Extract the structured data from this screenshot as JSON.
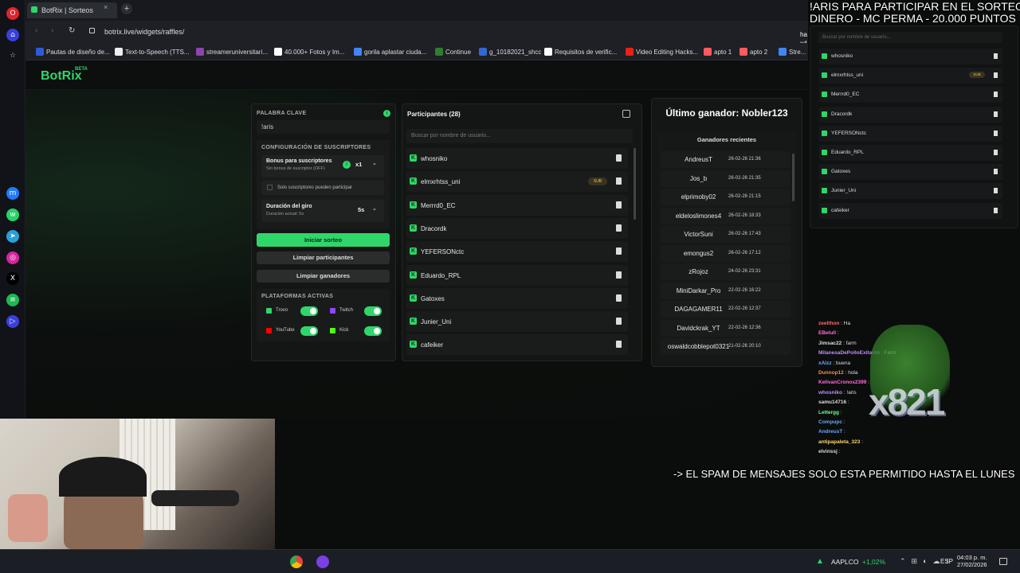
{
  "browser": {
    "tab_title": "BotRix | Sorteos",
    "tab_close": "×",
    "new_tab": "+",
    "url": "botrix.live/widgets/raffles/",
    "bookmarks": [
      "Pautas de diseño de...",
      "Text-to-Speech (TTS...",
      "streameruniversitari...",
      "40.000+ Fotos y Im...",
      "gorila aplastar ciuda...",
      "Continue",
      "g_10182021_shcc",
      "Requisitos de verific...",
      "Video Editing Hacks...",
      "apto 1",
      "apto 2",
      "Stre..."
    ],
    "partial_text": "ha xd"
  },
  "site": {
    "logo": "BotRix",
    "beta": "BETA"
  },
  "config": {
    "keyword_label": "PALABRA CLAVE",
    "keyword_value": "!aris",
    "subs_title": "CONFIGURACIÓN DE SUSCRIPTORES",
    "bonus_label": "Bonus para suscriptores",
    "bonus_sub": "Sin bonus de suscriptor (OFF)",
    "bonus_value": "x1",
    "subs_only": "Solo suscriptores pueden participar",
    "duration_label": "Duración del giro",
    "duration_sub": "Duración actual: 5s",
    "duration_value": "5s",
    "start_btn": "Iniciar sorteo",
    "clear_participants": "Limpiar participantes",
    "clear_winners": "Limpiar ganadores",
    "platforms_title": "PLATAFORMAS ACTIVAS",
    "platforms": [
      {
        "name": "Trovo",
        "on": true
      },
      {
        "name": "Twitch",
        "on": true
      },
      {
        "name": "YouTube",
        "on": true
      },
      {
        "name": "Kick",
        "on": true
      }
    ],
    "accent": "#2fd66a"
  },
  "participants": {
    "title": "Participantes (28)",
    "search_placeholder": "Buscar por nombre de usuario...",
    "list": [
      "whosniko",
      "elmxrhtss_uni",
      "Merrrd0_EC",
      "Dracordk",
      "YEFERSONctc",
      "Eduardo_RPL",
      "Gatoxes",
      "Junier_Uni",
      "cafeiker"
    ],
    "sub_badge": "SUB"
  },
  "winners": {
    "last_winner": "Último ganador: Nobler123",
    "recent_title": "Ganadores recientes",
    "list": [
      {
        "name": "AndreusT",
        "date": "26-02-26 21:36"
      },
      {
        "name": "Jos_b",
        "date": "26-02-26 21:35"
      },
      {
        "name": "elprimoby02",
        "date": "26-02-26 21:15"
      },
      {
        "name": "eldeloslimones4",
        "date": "26-02-26 18:33"
      },
      {
        "name": "VictorSuni",
        "date": "26-02-26 17:43"
      },
      {
        "name": "emongus2",
        "date": "26-02-26 17:12"
      },
      {
        "name": "zRojoz",
        "date": "24-02-26 23:31"
      },
      {
        "name": "MiniDarkar_Pro",
        "date": "22-02-26 16:22"
      },
      {
        "name": "DAGAGAMER11",
        "date": "22-02-26 12:37"
      },
      {
        "name": "Davidckrak_YT",
        "date": "22-02-26 12:36"
      },
      {
        "name": "oswaldcobblepot0321",
        "date": "21-02-26 20:10"
      }
    ]
  },
  "overlay": {
    "banner_line1": "!ARIS PARA PARTICIPAR EN EL SORTEO:",
    "banner_line2": "DINERO - MC PERMA - 20.000 PUNTOS",
    "search_placeholder": "Buscar por nombre de usuario...",
    "list": [
      "whosniko",
      "elmxrhtss_uni",
      "Merrrd0_EC",
      "Dracordk",
      "YEFERSONctc",
      "Eduardo_RPL",
      "Gatoxes",
      "Junier_Uni",
      "cafeiker"
    ],
    "sub_badge": "SUB",
    "spam_notice": "-> EL SPAM DE MENSAJES SOLO ESTA PERMITIDO HASTA EL LUNES",
    "counter": "x821"
  },
  "chat": [
    {
      "user": "zeelthon",
      "msg": "Ha",
      "color": "#ff6b6b"
    },
    {
      "user": "EBelull",
      "msg": "",
      "color": "#ff6bd6"
    },
    {
      "user": "Jimsac22",
      "msg": "farm",
      "color": "#ddd"
    },
    {
      "user": "MilanesaDePolloExitante",
      "msg": "Farm",
      "color": "#c48bff"
    },
    {
      "user": "xAlzz",
      "msg": "buena",
      "color": "#6ba7ff"
    },
    {
      "user": "Dunnop12",
      "msg": "hola",
      "color": "#ff8b3d"
    },
    {
      "user": "KelivanCronos2399",
      "msg": "",
      "color": "#ff6bd6"
    },
    {
      "user": "whosniko",
      "msg": "!aris",
      "color": "#c48bff"
    },
    {
      "user": "samu14716",
      "msg": "",
      "color": "#ddd"
    },
    {
      "user": "Lettergg",
      "msg": "",
      "color": "#6bff8b"
    },
    {
      "user": "Compupc",
      "msg": "",
      "color": "#6ba7ff"
    },
    {
      "user": "AndreusT",
      "msg": "",
      "color": "#6ba7ff"
    },
    {
      "user": "antipapaleta_323",
      "msg": "",
      "color": "#ffd86b"
    },
    {
      "user": "elvinssj",
      "msg": "",
      "color": "#ddd"
    }
  ],
  "taskbar": {
    "stock": "AAPLCO",
    "change": "+1,02%",
    "lang": "ESP",
    "time": "04:03 p. m.",
    "date": "27/02/2026"
  }
}
